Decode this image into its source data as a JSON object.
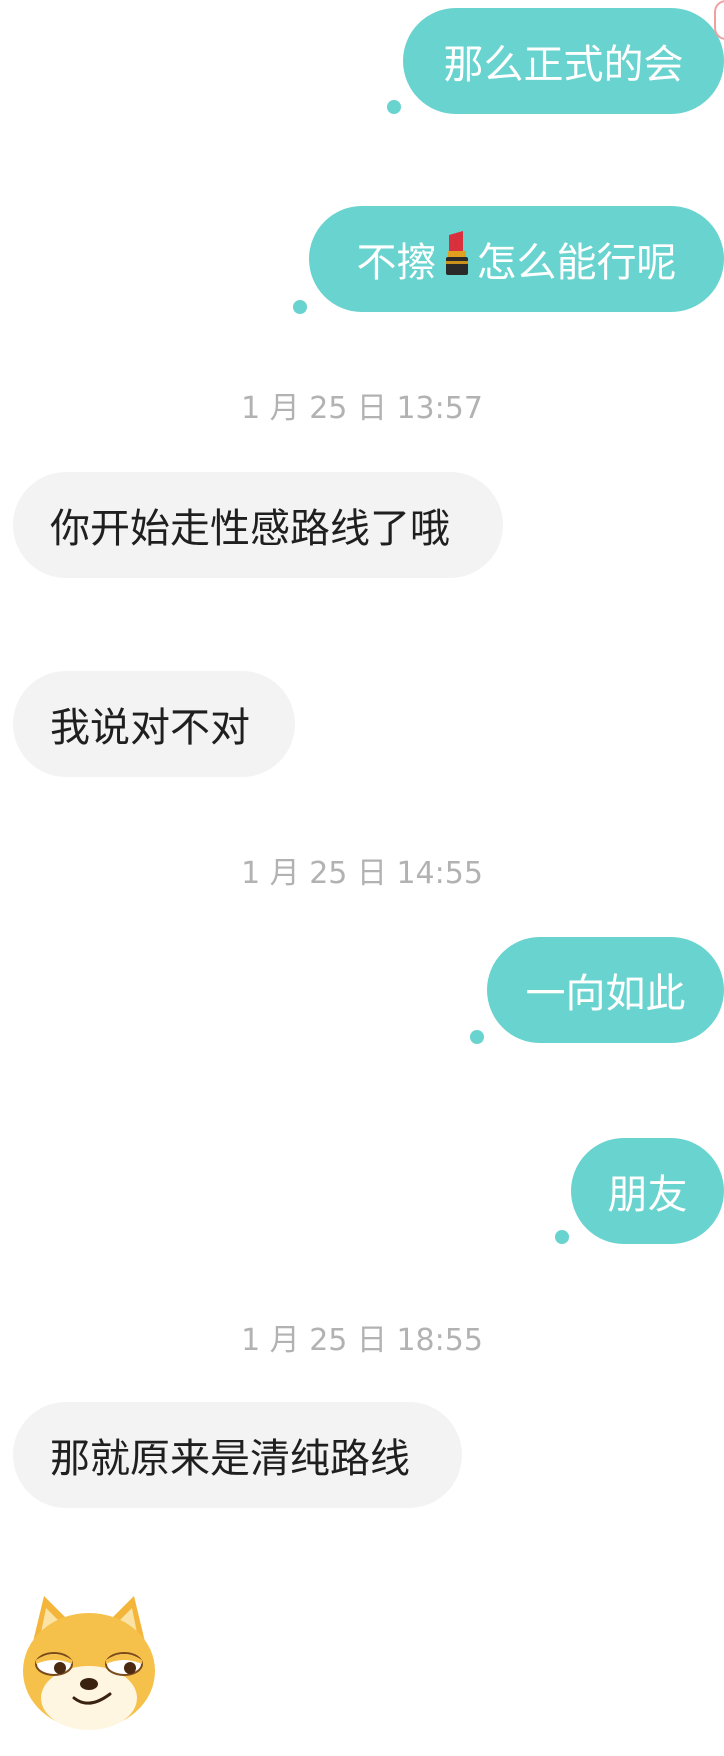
{
  "messages": [
    {
      "type": "out",
      "text": "那么正式的会"
    },
    {
      "type": "out",
      "pre": "不擦",
      "emoji": "lipstick-emoji",
      "post": "怎么能行呢"
    },
    {
      "type": "timestamp",
      "text": "1 月 25 日 13:57"
    },
    {
      "type": "in",
      "text": "你开始走性感路线了哦"
    },
    {
      "type": "in",
      "text": "我说对不对"
    },
    {
      "type": "timestamp",
      "text": "1 月 25 日 14:55"
    },
    {
      "type": "out",
      "text": "一向如此"
    },
    {
      "type": "out",
      "text": "朋友"
    },
    {
      "type": "timestamp",
      "text": "1 月 25 日 18:55"
    },
    {
      "type": "in",
      "text": "那就原来是清纯路线"
    },
    {
      "type": "in-sticker",
      "icon": "shiba-dog-smirk-sticker"
    }
  ],
  "colors": {
    "outgoing_bubble": "#69d3cf",
    "incoming_bubble": "#f3f3f3",
    "timestamp_text": "#b2b2b2"
  }
}
